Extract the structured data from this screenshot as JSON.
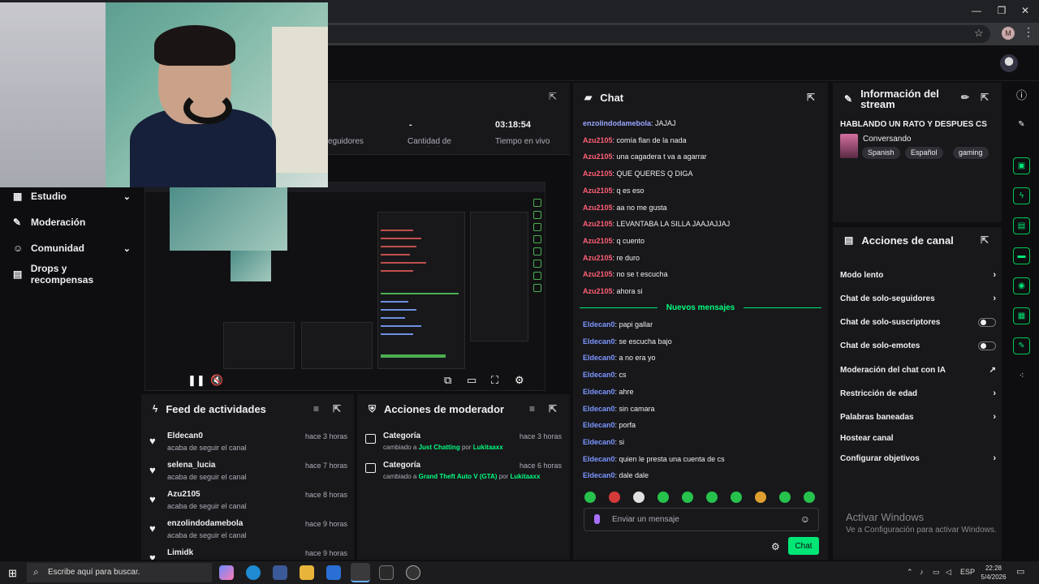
{
  "browser": {
    "window_controls": [
      "—",
      "❐",
      "✕"
    ],
    "profile_initial": "M"
  },
  "sidebar": {
    "items": [
      {
        "label": "Estudio",
        "icon": "film-icon",
        "expandable": true
      },
      {
        "label": "Moderación",
        "icon": "wrench-icon",
        "expandable": false
      },
      {
        "label": "Comunidad",
        "icon": "people-icon",
        "expandable": true
      },
      {
        "label": "Drops y recompensas",
        "icon": "gift-icon",
        "expandable": false
      }
    ]
  },
  "stats": {
    "followers_label": "eguidores",
    "subs_value": "-",
    "subs_label": "Cantidad de suscripciones",
    "live_value": "03:18:54",
    "live_label": "Tiempo en vivo"
  },
  "feed": {
    "title": "Feed de actividades",
    "items": [
      {
        "name": "Eldecan0",
        "sub": "acaba de seguir el canal",
        "time": "hace 3 horas"
      },
      {
        "name": "selena_lucia",
        "sub": "acaba de seguir el canal",
        "time": "hace 7 horas"
      },
      {
        "name": "Azu2105",
        "sub": "acaba de seguir el canal",
        "time": "hace 8 horas"
      },
      {
        "name": "enzolindodamebola",
        "sub": "acaba de seguir el canal",
        "time": "hace 9 horas"
      },
      {
        "name": "Limidk",
        "sub": "",
        "time": "hace 9 horas"
      }
    ]
  },
  "mod_actions": {
    "title": "Acciones de moderador",
    "items": [
      {
        "title": "Categoría",
        "prefix": "cambiado a",
        "target": "Just Chatting",
        "by": "por",
        "user": "Lukitaaxx",
        "time": "hace 3 horas"
      },
      {
        "title": "Categoría",
        "prefix": "cambiado a",
        "target": "Grand Theft Auto V (GTA)",
        "by": "por",
        "user": "Lukitaaxx",
        "time": "hace 6 horas"
      }
    ]
  },
  "chat": {
    "title": "Chat",
    "messages": [
      {
        "user": "enzolindodamebola",
        "kind": "enz",
        "text": ": JAJAJ"
      },
      {
        "user": "Azu2105",
        "kind": "azu",
        "text": ": comía flan de la nada"
      },
      {
        "user": "Azu2105",
        "kind": "azu",
        "text": ": una cagadera t va a agarrar"
      },
      {
        "user": "Azu2105",
        "kind": "azu",
        "text": ": QUE QUERES Q DIGA"
      },
      {
        "user": "Azu2105",
        "kind": "azu",
        "text": ": q es eso"
      },
      {
        "user": "Azu2105",
        "kind": "azu",
        "text": ": aa no me gusta"
      },
      {
        "user": "Azu2105",
        "kind": "azu",
        "text": ": LEVANTABA LA SILLA JAAJAJJAJ"
      },
      {
        "user": "Azu2105",
        "kind": "azu",
        "text": ": q cuento"
      },
      {
        "user": "Azu2105",
        "kind": "azu",
        "text": ": re duro"
      },
      {
        "user": "Azu2105",
        "kind": "azu",
        "text": ": no se t escucha"
      },
      {
        "user": "Azu2105",
        "kind": "azu",
        "text": ": ahora si"
      }
    ],
    "new_messages_label": "Nuevos mensajes",
    "new_messages": [
      {
        "user": "Eldecan0",
        "kind": "eld",
        "text": ": papi gallar"
      },
      {
        "user": "Eldecan0",
        "kind": "eld",
        "text": ": se escucha bajo"
      },
      {
        "user": "Eldecan0",
        "kind": "eld",
        "text": ": a no era yo"
      },
      {
        "user": "Eldecan0",
        "kind": "eld",
        "text": ": cs"
      },
      {
        "user": "Eldecan0",
        "kind": "eld",
        "text": ": ahre"
      },
      {
        "user": "Eldecan0",
        "kind": "eld",
        "text": ": sin camara"
      },
      {
        "user": "Eldecan0",
        "kind": "eld",
        "text": ": porfa"
      },
      {
        "user": "Eldecan0",
        "kind": "eld",
        "text": ": si"
      },
      {
        "user": "Eldecan0",
        "kind": "eld",
        "text": ": quien le presta una cuenta de cs"
      },
      {
        "user": "Eldecan0",
        "kind": "eld",
        "text": ": dale dale"
      }
    ],
    "input_placeholder": "Enviar un mensaje",
    "send_label": "Chat"
  },
  "stream_info": {
    "title": "Información del stream",
    "stream_title": "HABLANDO UN RATO Y DESPUES CS",
    "category": "Conversando",
    "tags": [
      "Spanish",
      "Español",
      "gaming"
    ]
  },
  "channel_actions": {
    "title": "Acciones de canal",
    "items": [
      {
        "label": "Modo lento",
        "control": "chevron"
      },
      {
        "label": "Chat de solo-seguidores",
        "control": "chevron"
      },
      {
        "label": "Chat de solo-suscriptores",
        "control": "toggle"
      },
      {
        "label": "Chat de solo-emotes",
        "control": "toggle"
      },
      {
        "label": "Moderación del chat con IA",
        "control": "external"
      },
      {
        "label": "Restricción de edad",
        "control": "chevron"
      },
      {
        "label": "Palabras baneadas",
        "control": "chevron"
      },
      {
        "label": "Hostear canal",
        "control": "none"
      },
      {
        "label": "Configurar objetivos",
        "control": "chevron"
      }
    ]
  },
  "windows_watermark": {
    "line1": "Activar Windows",
    "line2": "Ve a Configuración para activar Windows."
  },
  "taskbar": {
    "search_placeholder": "Escribe aquí para buscar.",
    "language": "ESP",
    "time": "22:28",
    "date": "5/4/2026"
  },
  "colors": {
    "accent": "#00e676",
    "azu": "#ff5f74",
    "eldecan": "#7c96ff",
    "enzo": "#9aa6ff"
  }
}
